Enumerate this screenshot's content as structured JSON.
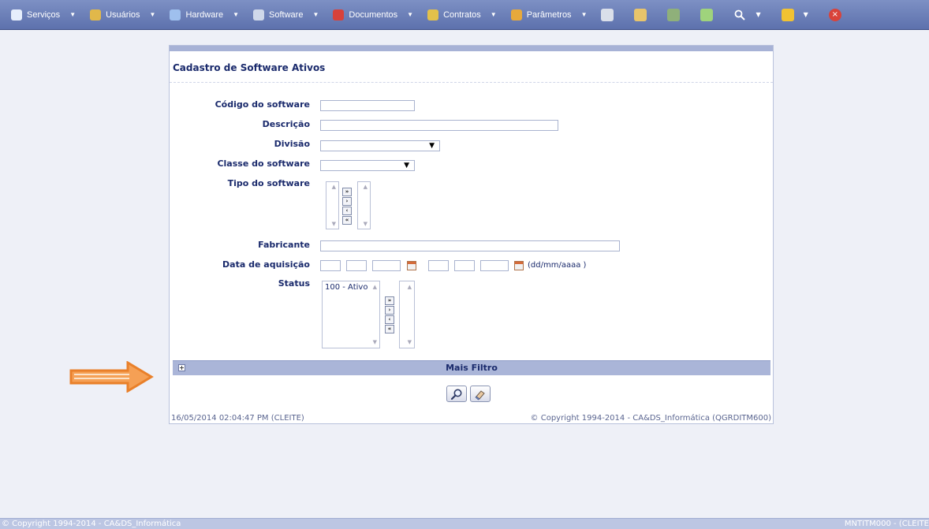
{
  "menu": {
    "items": [
      {
        "label": "Serviços",
        "icon": "services-icon",
        "color": "#e6eefc"
      },
      {
        "label": "Usuários",
        "icon": "users-icon",
        "color": "#e1b84a"
      },
      {
        "label": "Hardware",
        "icon": "monitor-icon",
        "color": "#9fc0ee"
      },
      {
        "label": "Software",
        "icon": "software-icon",
        "color": "#cfd8ea"
      },
      {
        "label": "Documentos",
        "icon": "book-icon",
        "color": "#d8413a"
      },
      {
        "label": "Contratos",
        "icon": "contract-icon",
        "color": "#e3c14b"
      },
      {
        "label": "Parâmetros",
        "icon": "parameters-icon",
        "color": "#e7a93c"
      }
    ],
    "tools": [
      {
        "icon": "camera-icon",
        "color": "#dadfea"
      },
      {
        "icon": "edit-icon",
        "color": "#e8c46b"
      },
      {
        "icon": "gear-icon",
        "color": "#8fb07a"
      },
      {
        "icon": "add-document-icon",
        "color": "#9fd37c"
      },
      {
        "icon": "search-icon",
        "color": "#ffffff"
      },
      {
        "icon": "traffic-light-icon",
        "color": "#f1c232"
      },
      {
        "icon": "close-icon",
        "color": "#d9433a"
      }
    ]
  },
  "form": {
    "title": "Cadastro de Software Ativos",
    "labels": {
      "codigo": "Código do software",
      "descricao": "Descrição",
      "divisao": "Divisão",
      "classe": "Classe do software",
      "tipo": "Tipo do software",
      "fabricante": "Fabricante",
      "data": "Data de aquisição",
      "status": "Status"
    },
    "values": {
      "codigo": "",
      "descricao": "",
      "divisao": "",
      "classe": "",
      "fabricante": "",
      "data_from_day": "",
      "data_from_month": "",
      "data_from_year": "",
      "data_to_day": "",
      "data_to_month": "",
      "data_to_year": ""
    },
    "date_hint": "(dd/mm/aaaa )",
    "status_items": [
      "100 - Ativo"
    ],
    "more_filter": "Mais Filtro",
    "footer_left": "16/05/2014  02:04:47 PM (CLEITE)",
    "footer_right": "© Copyright 1994-2014 - CA&DS_Informática (QGRDITM600)"
  },
  "statusbar": {
    "left": "© Copyright 1994-2014 - CA&DS_Informática",
    "right": "MNTITM000 - (CLEITE"
  },
  "colors": {
    "menubar": "#6a7eb8",
    "accent_orange": "#f08a2c",
    "label_text": "#1a2a6c"
  }
}
